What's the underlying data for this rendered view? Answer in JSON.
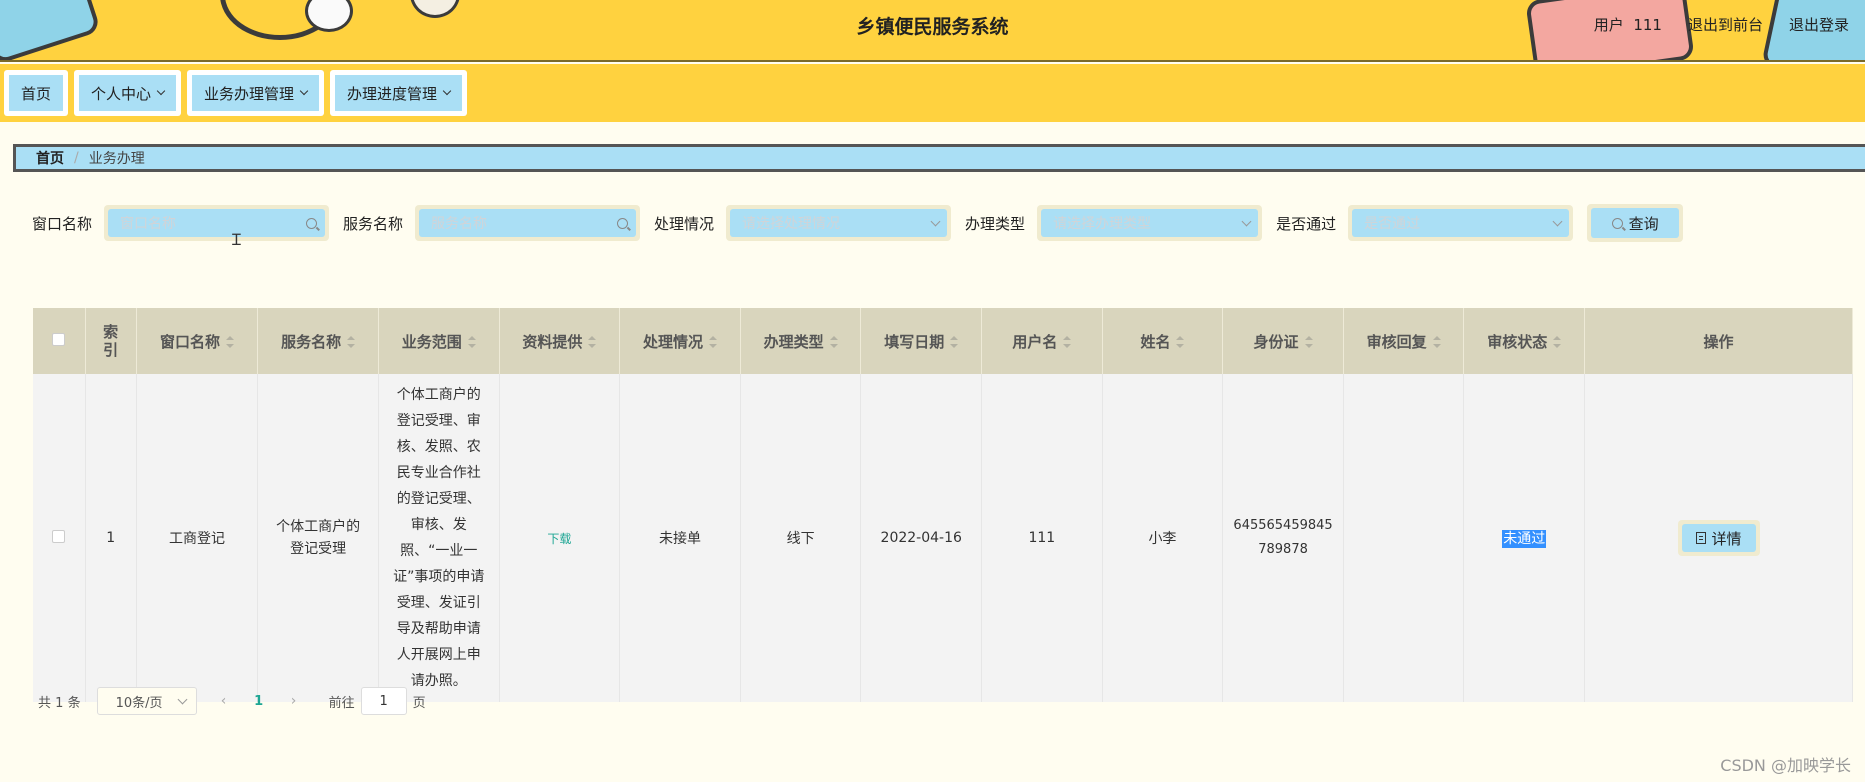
{
  "header": {
    "title": "乡镇便民服务系统",
    "user_label": "用户",
    "user_name": "111",
    "to_front": "退出到前台",
    "logout": "退出登录"
  },
  "nav": [
    {
      "label": "首页",
      "has_dropdown": false
    },
    {
      "label": "个人中心",
      "has_dropdown": true
    },
    {
      "label": "业务办理管理",
      "has_dropdown": true
    },
    {
      "label": "办理进度管理",
      "has_dropdown": true
    }
  ],
  "breadcrumb": {
    "home": "首页",
    "sep": "/",
    "current": "业务办理"
  },
  "search": {
    "fields": [
      {
        "label": "窗口名称",
        "placeholder": "窗口名称",
        "type": "input"
      },
      {
        "label": "服务名称",
        "placeholder": "服务名称",
        "type": "input"
      },
      {
        "label": "处理情况",
        "placeholder": "请选择处理情况",
        "type": "select"
      },
      {
        "label": "办理类型",
        "placeholder": "请选择办理类型",
        "type": "select"
      },
      {
        "label": "是否通过",
        "placeholder": "是否通过",
        "type": "select"
      }
    ],
    "query_label": "查询"
  },
  "table": {
    "columns": [
      "索引",
      "窗口名称",
      "服务名称",
      "业务范围",
      "资料提供",
      "处理情况",
      "办理类型",
      "填写日期",
      "用户名",
      "姓名",
      "身份证",
      "审核回复",
      "审核状态",
      "操作"
    ],
    "rows": [
      {
        "index": "1",
        "window_name": "工商登记",
        "service_name": "个体工商户的登记受理",
        "scope": "个体工商户的登记受理、审核、发照、农民专业合作社的登记受理、审核、发照、“一业一证”事项的申请受理、发证引导及帮助申请人开展网上申请办照。",
        "materials": "下载",
        "process_status": "未接单",
        "handle_type": "线下",
        "date": "2022-04-16",
        "username": "111",
        "name": "小李",
        "id_card": "645565459845789878",
        "review_reply": "",
        "review_status": "未通过",
        "action": "详情"
      }
    ]
  },
  "pagination": {
    "total_prefix": "共",
    "total": "1",
    "total_suffix": "条",
    "page_size": "10条/页",
    "current_page": "1",
    "goto_prefix": "前往",
    "goto_value": "1",
    "goto_suffix": "页"
  },
  "watermark": "CSDN @加映学长"
}
